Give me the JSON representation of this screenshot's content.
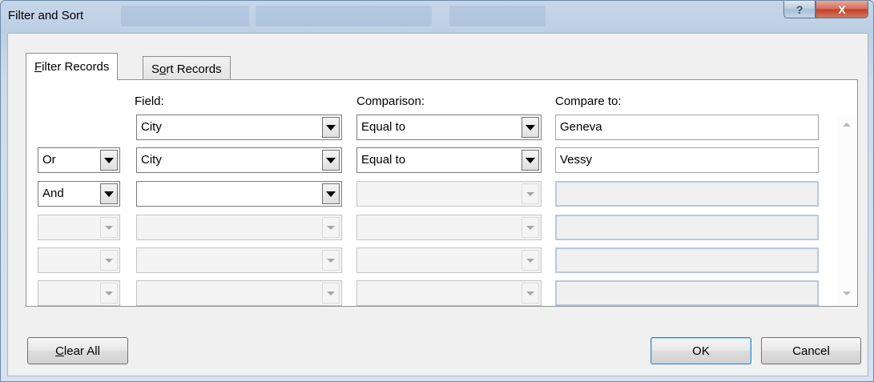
{
  "window": {
    "title": "Filter and Sort",
    "help_icon": "?",
    "close_icon": "X"
  },
  "tabs": [
    {
      "access_key": "F",
      "rest": "ilter Records",
      "active": true
    },
    {
      "prefix": "S",
      "access_key": "o",
      "rest": "rt Records",
      "active": false
    }
  ],
  "headers": {
    "field": "Field:",
    "comparison": "Comparison:",
    "compare_to": "Compare to:"
  },
  "rows": [
    {
      "logic": "",
      "field": "City",
      "comparison": "Equal to",
      "compare_to": "Geneva",
      "enabled": true
    },
    {
      "logic": "Or",
      "field": "City",
      "comparison": "Equal to",
      "compare_to": "Vessy",
      "enabled": true
    },
    {
      "logic": "And",
      "field": "",
      "comparison": "",
      "compare_to": "",
      "enabled": "partial"
    },
    {
      "logic": "",
      "field": "",
      "comparison": "",
      "compare_to": "",
      "enabled": false
    },
    {
      "logic": "",
      "field": "",
      "comparison": "",
      "compare_to": "",
      "enabled": false
    },
    {
      "logic": "",
      "field": "",
      "comparison": "",
      "compare_to": "",
      "enabled": false
    }
  ],
  "buttons": {
    "clear_all_key": "C",
    "clear_all_rest": "lear All",
    "ok": "OK",
    "cancel": "Cancel"
  },
  "icons": {
    "dropdown": "chevron-down-icon",
    "scroll_up": "scroll-up-arrow-icon",
    "scroll_down": "scroll-down-arrow-icon"
  }
}
